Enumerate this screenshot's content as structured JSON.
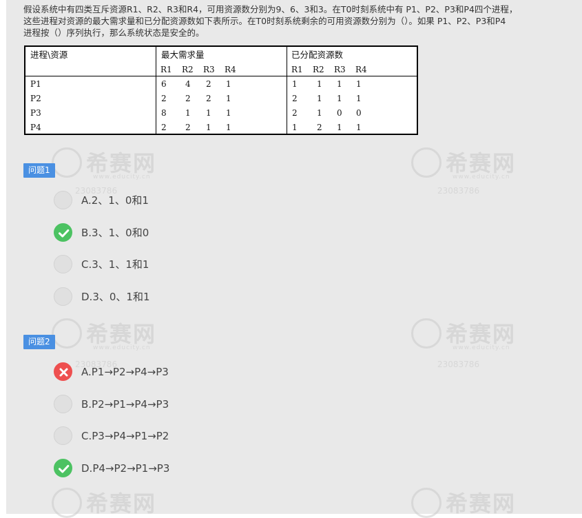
{
  "question": {
    "lines": [
      "假设系统中有四类互斥资源R1、R2、R3和R4，可用资源数分别为9、6、3和3。在T0时刻系统中有 P1、P2、P3和P4四个进程，",
      "这些进程对资源的最大需求量和已分配资源数如下表所示。在T0时刻系统剩余的可用资源数分别为（）。如果 P1、P2、P3和P4",
      "进程按（）序列执行，那么系统状态是安全的。"
    ]
  },
  "resource_table": {
    "corner_header": "进程\\资源",
    "max_header": "最大需求量",
    "alloc_header": "已分配资源数",
    "resources": [
      "R1",
      "R2",
      "R3",
      "R4"
    ],
    "rows": [
      {
        "process": "P1",
        "max": [
          "6",
          "4",
          "2",
          "1"
        ],
        "alloc": [
          "1",
          "1",
          "1",
          "1"
        ]
      },
      {
        "process": "P2",
        "max": [
          "2",
          "2",
          "2",
          "1"
        ],
        "alloc": [
          "2",
          "1",
          "1",
          "1"
        ]
      },
      {
        "process": "P3",
        "max": [
          "8",
          "1",
          "1",
          "1"
        ],
        "alloc": [
          "2",
          "1",
          "0",
          "0"
        ]
      },
      {
        "process": "P4",
        "max": [
          "2",
          "2",
          "1",
          "1"
        ],
        "alloc": [
          "1",
          "2",
          "1",
          "1"
        ]
      }
    ]
  },
  "watermark": {
    "brand": "希赛网",
    "site": "www.educity.cn",
    "code": "23083786"
  },
  "questions": [
    {
      "label": "问题1",
      "options": [
        {
          "text": "A.2、1、0和1",
          "state": "none"
        },
        {
          "text": "B.3、1、0和0",
          "state": "correct"
        },
        {
          "text": "C.3、1、1和1",
          "state": "none"
        },
        {
          "text": "D.3、0、1和1",
          "state": "none"
        }
      ]
    },
    {
      "label": "问题2",
      "options": [
        {
          "text": "A.P1→P2→P4→P3",
          "state": "wrong"
        },
        {
          "text": "B.P2→P1→P4→P3",
          "state": "none"
        },
        {
          "text": "C.P3→P4→P1→P2",
          "state": "none"
        },
        {
          "text": "D.P4→P2→P1→P3",
          "state": "correct"
        }
      ]
    }
  ],
  "colors": {
    "label_bg": "#4a90e2",
    "correct": "#4cc262",
    "wrong": "#ee4f4f",
    "panel_bg": "#e9e9e9"
  }
}
